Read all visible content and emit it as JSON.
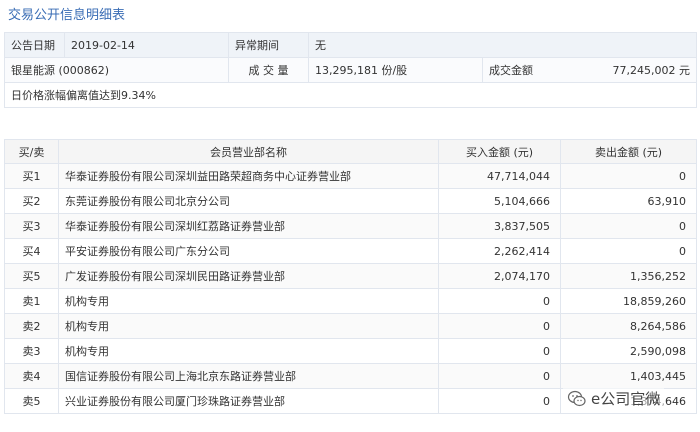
{
  "title": "交易公开信息明细表",
  "info": {
    "announce_date_label": "公告日期",
    "announce_date": "2019-02-14",
    "abnormal_period_label": "异常期间",
    "abnormal_period": "无",
    "stock": "银星能源 (000862)",
    "volume_label": "成 交 量",
    "volume": "13,295,181 份/股",
    "amount_label": "成交金额",
    "amount": "77,245,002 元",
    "reason": "日价格涨幅偏离值达到9.34%"
  },
  "table": {
    "headers": [
      "买/卖",
      "会员营业部名称",
      "买入金额 (元)",
      "卖出金额 (元)"
    ],
    "rows": [
      {
        "dir": "买1",
        "name": "华泰证券股份有限公司深圳益田路荣超商务中心证券营业部",
        "buy": "47,714,044",
        "sell": "0"
      },
      {
        "dir": "买2",
        "name": "东莞证券股份有限公司北京分公司",
        "buy": "5,104,666",
        "sell": "63,910"
      },
      {
        "dir": "买3",
        "name": "华泰证券股份有限公司深圳红荔路证券营业部",
        "buy": "3,837,505",
        "sell": "0"
      },
      {
        "dir": "买4",
        "name": "平安证券股份有限公司广东分公司",
        "buy": "2,262,414",
        "sell": "0"
      },
      {
        "dir": "买5",
        "name": "广发证券股份有限公司深圳民田路证券营业部",
        "buy": "2,074,170",
        "sell": "1,356,252"
      },
      {
        "dir": "卖1",
        "name": "机构专用",
        "buy": "0",
        "sell": "18,859,260"
      },
      {
        "dir": "卖2",
        "name": "机构专用",
        "buy": "0",
        "sell": "8,264,586"
      },
      {
        "dir": "卖3",
        "name": "机构专用",
        "buy": "0",
        "sell": "2,590,098"
      },
      {
        "dir": "卖4",
        "name": "国信证券股份有限公司上海北京东路证券营业部",
        "buy": "0",
        "sell": "1,403,445"
      },
      {
        "dir": "卖5",
        "name": "兴业证券股份有限公司厦门珍珠路证券营业部",
        "buy": "0",
        "sell": "1,374,646"
      }
    ]
  },
  "watermark": {
    "text": "e公司官微",
    "icon": "wechat-icon"
  }
}
